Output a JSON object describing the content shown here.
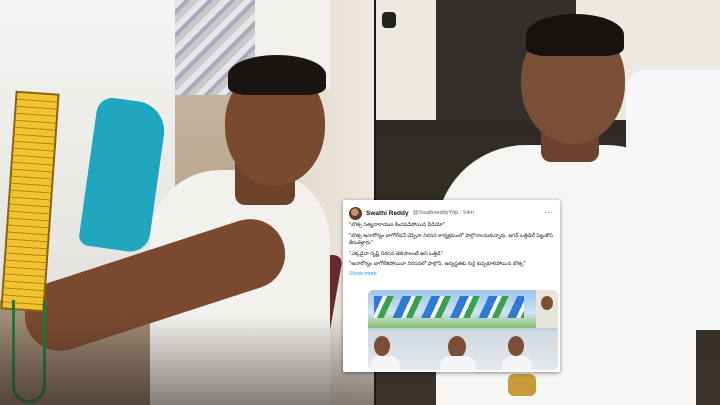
{
  "tweet": {
    "display_name": "Swathi Reddy",
    "handle_time": "@SwathireddyYdp · 54m",
    "more_glyph": "···",
    "lines": [
      "\"బొత్స సత్యనారాయణ కిందపడిపోయిన వీడియో\"",
      "\"బొత్స అనారోగ్యం బాగోలేదనే చెప్పినా నిరసన కార్యక్రమంలో పాల్గొనాలనుకున్నారు, జగన్ ఒత్తిడిల్ పెట్టుకొని తీసుకెళ్లారు\"",
      "\"ఎక్కడైనా సృష్టి నిరసన తెలిపాలంటే అని ఒత్తిడి\"",
      "\"అనారోగ్యం బాగోలేకపోయినా నిరసనలో పాల్గొని, అస్వస్థతకు గురై కుప్పకూలిపోయిన బొత్స\""
    ],
    "show_more": "Show more"
  }
}
